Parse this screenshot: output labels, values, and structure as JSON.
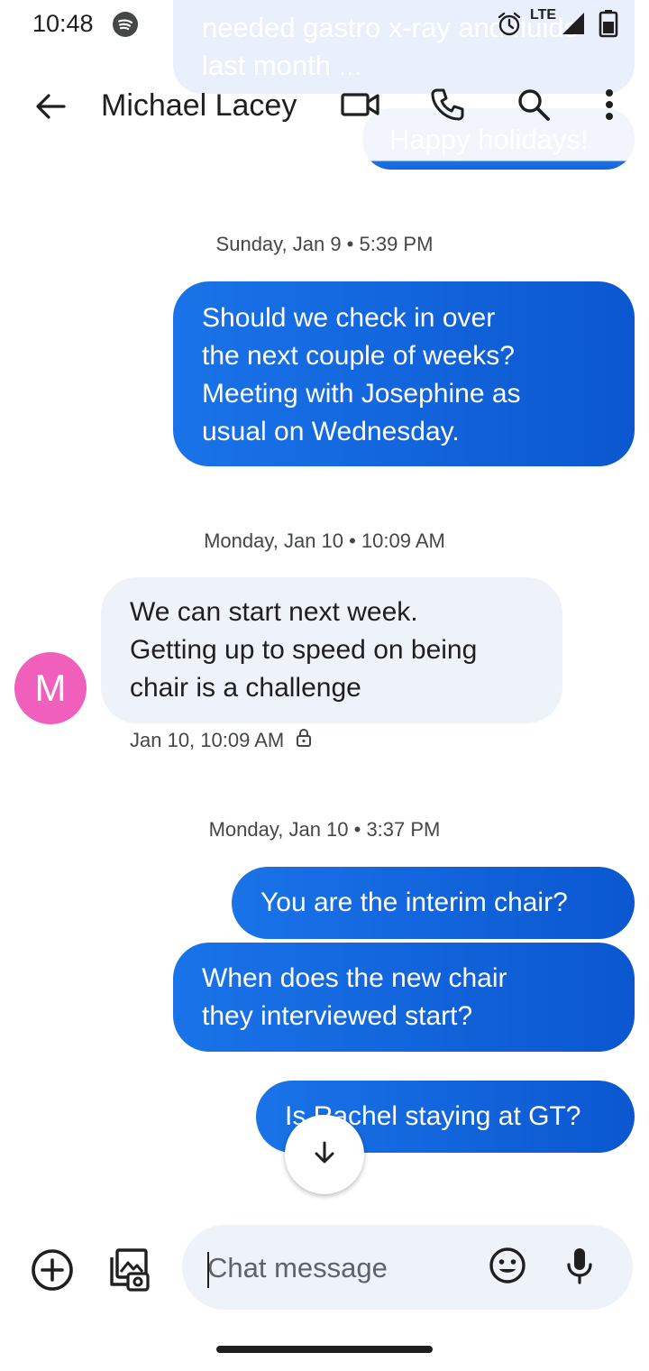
{
  "status_bar": {
    "time": "10:48",
    "network": "LTE",
    "icons": [
      "spotify-icon",
      "alarm-icon",
      "signal-icon",
      "battery-icon"
    ]
  },
  "header": {
    "contact_name": "Michael Lacey",
    "icons": [
      "back-arrow-icon",
      "video-call-icon",
      "phone-icon",
      "search-icon",
      "more-vert-icon"
    ]
  },
  "thread": {
    "scrolled_bubbles": [
      "needed gastro x-ray and fluids last month ...",
      "Happy holidays!"
    ],
    "groups": [
      {
        "timestamp": "Sunday, Jan 9 • 5:39 PM",
        "messages": [
          {
            "direction": "outgoing",
            "lines": [
              "Should we check in over",
              "the next couple of weeks?",
              "Meeting with Josephine as",
              "usual on Wednesday."
            ]
          }
        ]
      },
      {
        "timestamp": "Monday, Jan 10 • 10:09 AM",
        "messages": [
          {
            "direction": "incoming",
            "sender_initial": "M",
            "lines": [
              "We can start next week.",
              "Getting up to speed on being",
              "chair is a challenge"
            ],
            "meta": "Jan 10, 10:09 AM"
          }
        ]
      },
      {
        "timestamp": "Monday, Jan 10 • 3:37 PM",
        "messages": [
          {
            "direction": "outgoing",
            "lines": [
              "You are the interim chair?"
            ]
          },
          {
            "direction": "outgoing",
            "lines": [
              "When does the new chair",
              "they interviewed start?"
            ]
          },
          {
            "direction": "outgoing",
            "lines": [
              "Is Rachel staying at GT?"
            ]
          }
        ]
      }
    ]
  },
  "composer": {
    "placeholder": "Chat message",
    "icons": [
      "add-circle-icon",
      "gallery-icon",
      "emoji-icon",
      "mic-icon"
    ]
  },
  "colors": {
    "outgoing_bubble": "#1a73e8",
    "incoming_bubble": "#eef2f9",
    "avatar": "#f15fbd"
  }
}
